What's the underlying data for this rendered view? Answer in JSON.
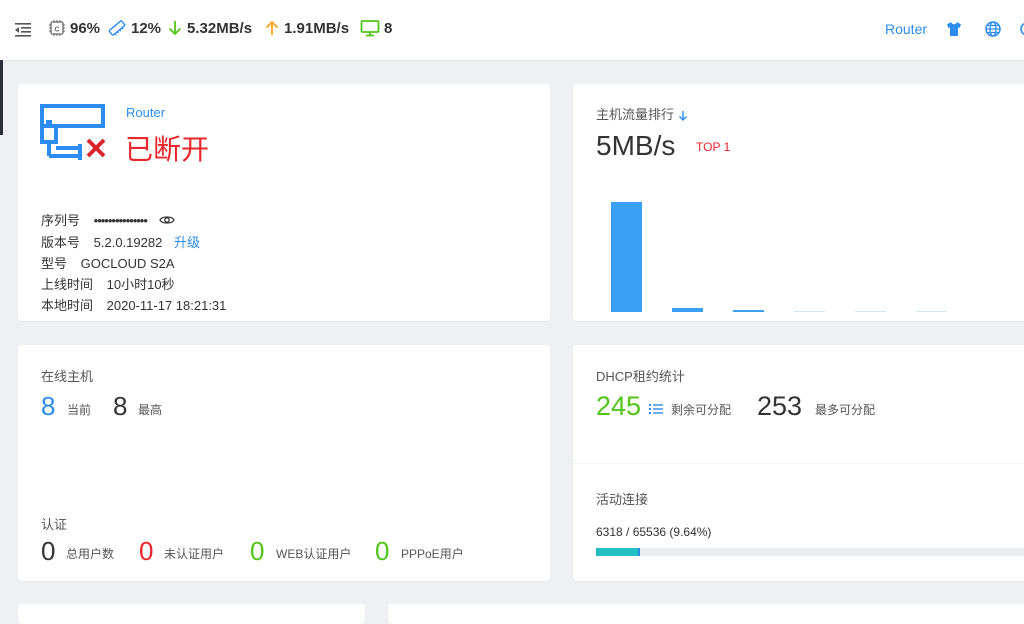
{
  "topbar": {
    "cpu": "96%",
    "mem": "12%",
    "down": "5.32MB/s",
    "up": "1.91MB/s",
    "hosts": "8",
    "router_link": "Router"
  },
  "device": {
    "name_link": "Router",
    "status": "已断开",
    "serial_label": "序列号",
    "serial_value": "•••••••••••••••",
    "version_label": "版本号",
    "version_value": "5.2.0.19282",
    "upgrade_label": "升级",
    "model_label": "型号",
    "model_value": "GOCLOUD S2A",
    "uptime_label": "上线时间",
    "uptime_value": "10小时10秒",
    "localtime_label": "本地时间",
    "localtime_value": "2020-11-17 18:21:31"
  },
  "traffic": {
    "title": "主机流量排行",
    "value": "5MB/s",
    "rank": "TOP 1",
    "bars": [
      1.0,
      0.04,
      0.015,
      0.008,
      0.005,
      0.003
    ]
  },
  "online": {
    "title": "在线主机",
    "current": "8",
    "current_label": "当前",
    "max": "8",
    "max_label": "最高",
    "auth_title": "认证",
    "total_users": "0",
    "total_users_label": "总用户数",
    "unauth_users": "0",
    "unauth_users_label": "未认证用户",
    "web_users": "0",
    "web_users_label": "WEB认证用户",
    "pppoe_users": "0",
    "pppoe_users_label": "PPPoE用户"
  },
  "dhcp": {
    "title": "DHCP租约统计",
    "remaining": "245",
    "remaining_label": "剩余可分配",
    "max": "253",
    "max_label": "最多可分配",
    "conn_title": "活动连接",
    "conn_text": "6318 / 65536 (9.64%)",
    "conn_fraction": 0.0964
  },
  "colors": {
    "accent": "#2d8cf0",
    "danger": "#e8262c",
    "success": "#52c41a",
    "progress": "#26c0c3"
  }
}
